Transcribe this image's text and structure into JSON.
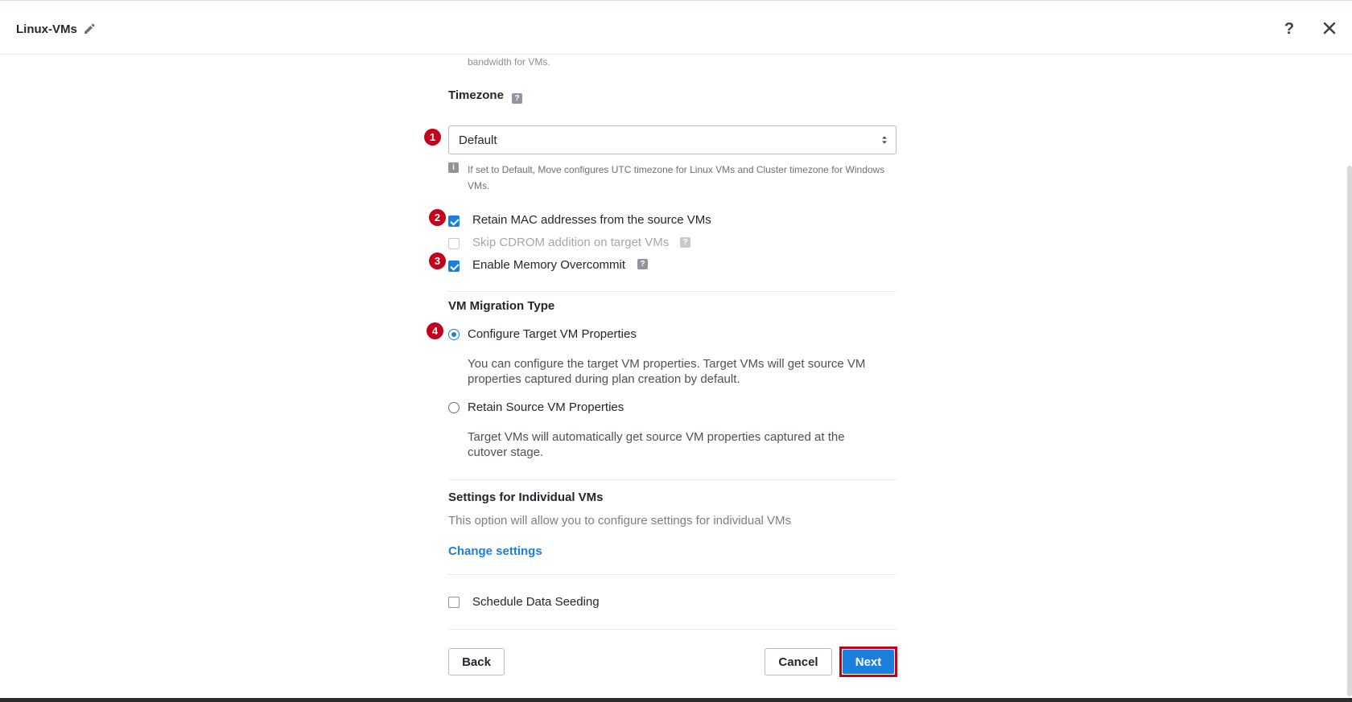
{
  "header": {
    "title": "Linux-VMs",
    "help_label": "?"
  },
  "bandwidth_note": "bandwidth for VMs.",
  "timezone": {
    "label": "Timezone",
    "selected": "Default",
    "info": "If set to Default, Move configures UTC timezone for Linux VMs and Cluster timezone for Windows VMs."
  },
  "options": [
    {
      "label": "Retain MAC addresses from the source VMs",
      "checked": true,
      "disabled": false
    },
    {
      "label": "Skip CDROM addition on target VMs",
      "checked": false,
      "disabled": true
    },
    {
      "label": "Enable Memory Overcommit",
      "checked": true,
      "disabled": false
    }
  ],
  "migration_type": {
    "title": "VM Migration Type",
    "options": [
      {
        "label": "Configure Target VM Properties",
        "selected": true,
        "description": "You can configure the target VM properties. Target VMs will get source VM properties captured during plan creation by default."
      },
      {
        "label": "Retain Source VM Properties",
        "selected": false,
        "description": "Target VMs will automatically get source VM properties captured at the cutover stage."
      }
    ]
  },
  "individual_settings": {
    "title": "Settings for Individual VMs",
    "description": "This option will allow you to configure settings for individual VMs",
    "link": "Change settings"
  },
  "schedule_seeding": {
    "label": "Schedule Data Seeding",
    "checked": false
  },
  "footer": {
    "back": "Back",
    "cancel": "Cancel",
    "next": "Next"
  },
  "markers": [
    "1",
    "2",
    "3",
    "4"
  ],
  "colors": {
    "accent": "#1b7fe0",
    "marker": "#c4001a",
    "text": "#22272e",
    "muted": "#7a8087"
  }
}
